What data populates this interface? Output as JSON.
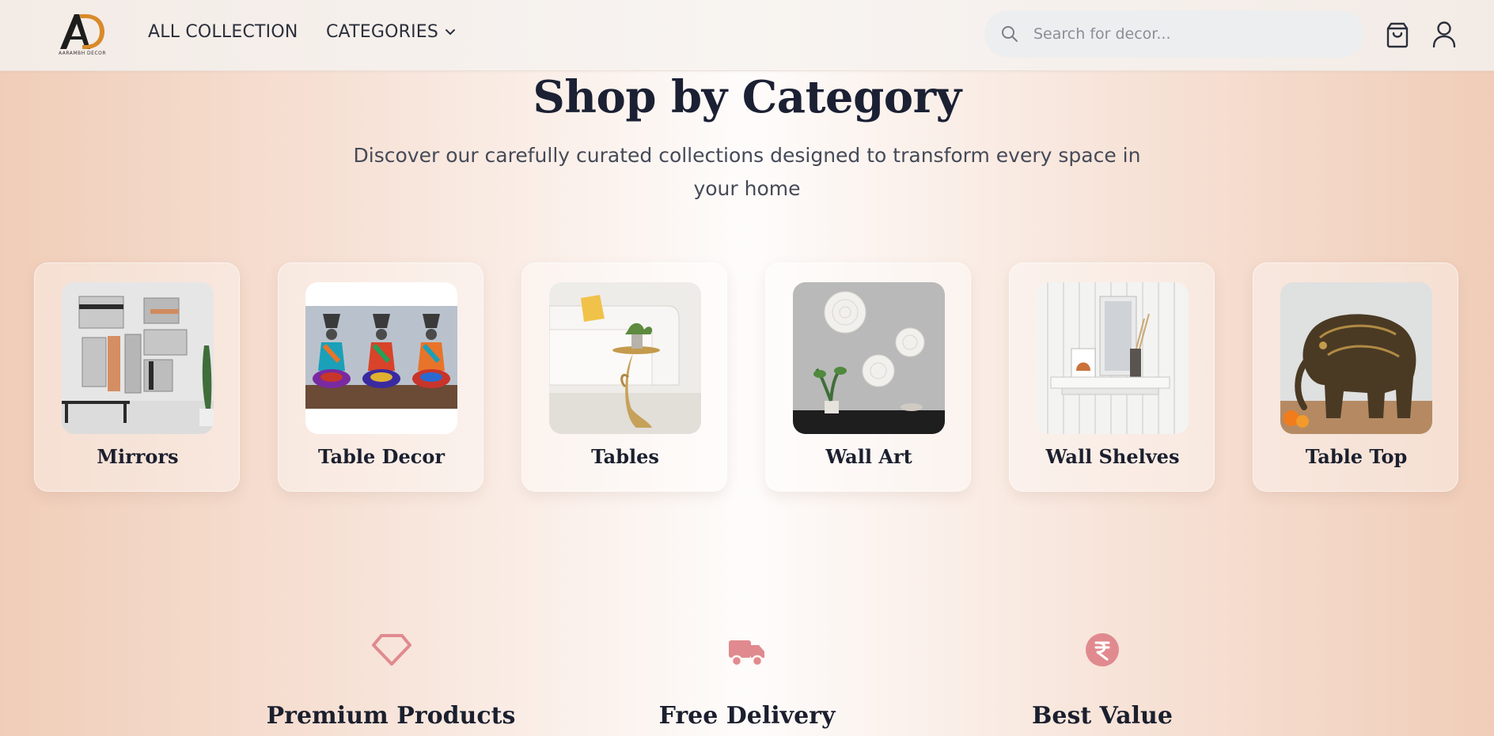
{
  "brand": {
    "name": "AD",
    "tagline": "AARAMBH DECOR",
    "accent": "#e08a8f"
  },
  "nav": {
    "all_collection": "ALL COLLECTION",
    "categories": "CATEGORIES"
  },
  "search": {
    "placeholder": "Search for decor...",
    "value": ""
  },
  "icons": {
    "search": "search-icon",
    "cart": "shopping-bag-icon",
    "user": "user-icon"
  },
  "hero": {
    "title": "Shop by Category",
    "subtitle": "Discover our carefully curated collections designed to transform every space in your home"
  },
  "categories": [
    {
      "label": "Mirrors"
    },
    {
      "label": "Table Decor"
    },
    {
      "label": "Tables"
    },
    {
      "label": "Wall Art"
    },
    {
      "label": "Wall Shelves"
    },
    {
      "label": "Table Top"
    }
  ],
  "features": [
    {
      "label": "Premium Products",
      "icon": "diamond-icon"
    },
    {
      "label": "Free Delivery",
      "icon": "truck-icon"
    },
    {
      "label": "Best Value",
      "icon": "rupee-icon"
    }
  ]
}
